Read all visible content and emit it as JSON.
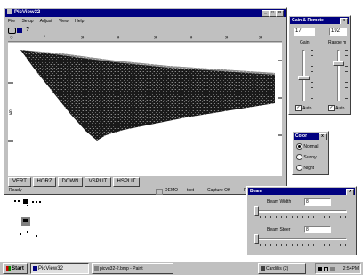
{
  "main_window": {
    "title": "PicView32",
    "menu": [
      "File",
      "Setup",
      "Adjust",
      "View",
      "Help"
    ],
    "ruler_marks": [
      "*",
      "»",
      "»",
      "»",
      "»",
      "»",
      "»"
    ],
    "side_marks": [
      "—",
      "§",
      "—"
    ],
    "view_buttons": [
      "VERT",
      "HORZ",
      "DOWN",
      "VSPLIT",
      "HSPLIT"
    ],
    "status": {
      "ready": "Ready",
      "demo": "DEMO",
      "mode": "text",
      "capture": "Capture Off",
      "extra": "R"
    }
  },
  "gain_remote": {
    "title": "Gain & Remote",
    "gain_value": "17",
    "range_value": "192",
    "gain_label": "Gain",
    "range_label": "Range m",
    "gain_auto_label": "Auto",
    "range_auto_label": "Auto",
    "gain_level": 0.55,
    "range_level": 0.25
  },
  "color_panel": {
    "title": "Color",
    "options": [
      "Normal",
      "Sunny",
      "Night"
    ],
    "selected": "Normal"
  },
  "beam_panel": {
    "title": "Beam",
    "width_label": "Beam Width",
    "width_value": "8",
    "steer_label": "Beam Steer",
    "steer_value": "8"
  },
  "taskbar": {
    "start_label": "Start",
    "tasks": [
      {
        "label": "PicView32",
        "active": true
      },
      {
        "label": "picvu32-2.bmp - Paint",
        "active": false
      }
    ],
    "tray_app": "Cardillis (2)",
    "clock": "2:54PM"
  },
  "icons": {
    "start": "windows-logo-icon",
    "paint": "paint-icon",
    "app": "sonar-app-icon"
  }
}
